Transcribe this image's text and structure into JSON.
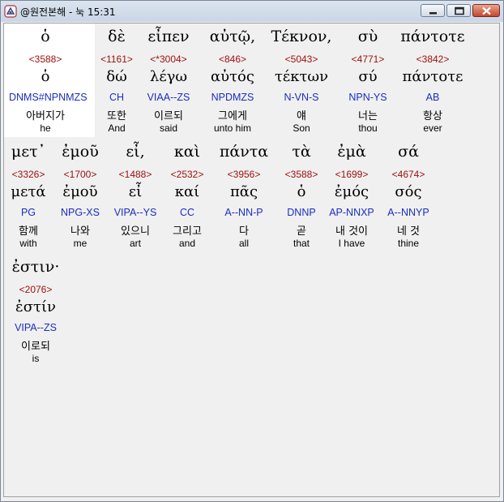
{
  "window": {
    "title": "@원전본해 - 눅 15:31",
    "controls": {
      "minimize_icon": "minimize-icon",
      "maximize_icon": "maximize-icon",
      "close_icon": "close-icon"
    },
    "close_color": "#c4452c"
  },
  "colors": {
    "greek": "#000000",
    "strong": "#a01010",
    "morph": "#1a2ec0",
    "korean": "#000000",
    "english": "#000000"
  },
  "selected_word_index": 0,
  "words": [
    {
      "greek": "ὁ",
      "strong": "<3588>",
      "lemma": "ὁ",
      "morph": "DNMS#NPNMZS",
      "korean": "아버지가",
      "english": "he"
    },
    {
      "greek": "δὲ",
      "strong": "<1161>",
      "lemma": "δώ",
      "morph": "CH",
      "korean": "또한",
      "english": "And"
    },
    {
      "greek": "εἶπεν",
      "strong": "<*3004>",
      "lemma": "λέγω",
      "morph": "VIAA--ZS",
      "korean": "이르되",
      "english": "said"
    },
    {
      "greek": "αὐτῷ,",
      "strong": "<846>",
      "lemma": "αὐτός",
      "morph": "NPDMZS",
      "korean": "그에게",
      "english": "unto him"
    },
    {
      "greek": "Τέκνον,",
      "strong": "<5043>",
      "lemma": "τέκτων",
      "morph": "N-VN-S",
      "korean": "얘",
      "english": "Son"
    },
    {
      "greek": "σὺ",
      "strong": "<4771>",
      "lemma": "σύ",
      "morph": "NPN-YS",
      "korean": "너는",
      "english": "thou"
    },
    {
      "greek": "πάντοτε",
      "strong": "<3842>",
      "lemma": "πάντοτε",
      "morph": "AB",
      "korean": "항상",
      "english": "ever"
    },
    {
      "greek": "μετ᾽",
      "strong": "<3326>",
      "lemma": "μετά",
      "morph": "PG",
      "korean": "함께",
      "english": "with"
    },
    {
      "greek": "ἐμοῦ",
      "strong": "<1700>",
      "lemma": "ἐμοῦ",
      "morph": "NPG-XS",
      "korean": "나와",
      "english": "me"
    },
    {
      "greek": "εἶ,",
      "strong": "<1488>",
      "lemma": "εἶ",
      "morph": "VIPA--YS",
      "korean": "있으니",
      "english": "art"
    },
    {
      "greek": "καὶ",
      "strong": "<2532>",
      "lemma": "καί",
      "morph": "CC",
      "korean": "그리고",
      "english": "and"
    },
    {
      "greek": "πάντα",
      "strong": "<3956>",
      "lemma": "πᾶς",
      "morph": "A--NN-P",
      "korean": "다",
      "english": "all"
    },
    {
      "greek": "τὰ",
      "strong": "<3588>",
      "lemma": "ὁ",
      "morph": "DNNP",
      "korean": "곧",
      "english": "that"
    },
    {
      "greek": "ἐμὰ",
      "strong": "<1699>",
      "lemma": "ἐμός",
      "morph": "AP-NNXP",
      "korean": "내 것이",
      "english": "I have"
    },
    {
      "greek": "σά",
      "strong": "<4674>",
      "lemma": "σός",
      "morph": "A--NNYP",
      "korean": "네 것",
      "english": "thine"
    },
    {
      "greek": "ἐστιν·",
      "strong": "<2076>",
      "lemma": "ἐστίν",
      "morph": "VIPA--ZS",
      "korean": "이로되",
      "english": "is"
    }
  ]
}
